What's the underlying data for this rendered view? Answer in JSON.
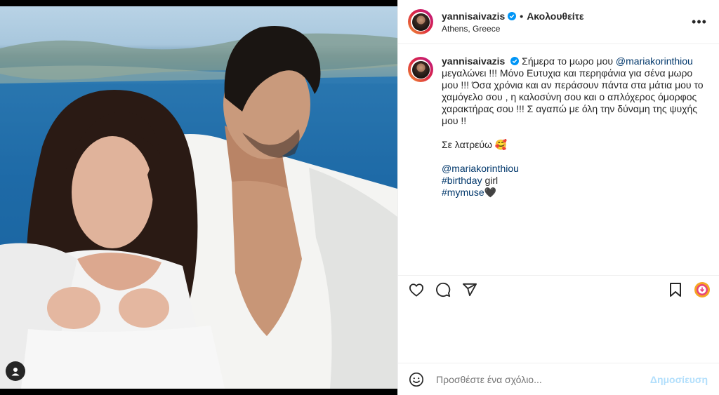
{
  "post": {
    "username": "yannisaivazis",
    "follow_status": "Ακολουθείτε",
    "location": "Athens, Greece"
  },
  "caption": {
    "username": "yannisaivazis",
    "intro": "Σήμερα το μωρο μου",
    "mention": "@mariakorinthiou",
    "body": "μεγαλώνει !!! Μόνο Ευτυχια και περηφάνια για σένα μωρο μου !!! Όσα χρόνια και αν περάσουν πάντα στα μάτια μου το χαμόγελο σου , η καλοσύνη σου και ο απλόχερος όμορφος χαρακτήρας σου !!! Σ αγαπώ με όλη την δύναμη της ψυχής μου !!",
    "love_line": "Σε λατρεύω 🥰",
    "mention2": "@mariakorinthiou",
    "hashtag1": "#birthday",
    "hashtag1_suffix": " girl",
    "hashtag2": "#mymuse",
    "hashtag2_suffix": "🖤"
  },
  "comment": {
    "placeholder": "Προσθέστε ένα σχόλιο...",
    "post_label": "Δημοσίευση"
  },
  "colors": {
    "link": "#00376b",
    "verified": "#0095f6",
    "post_disabled": "#b2dffc"
  },
  "icons": [
    "user-tag-icon",
    "more-options-icon",
    "verified-icon",
    "heart-icon",
    "comment-icon",
    "share-icon",
    "save-icon",
    "emoji-icon",
    "download-icon"
  ]
}
